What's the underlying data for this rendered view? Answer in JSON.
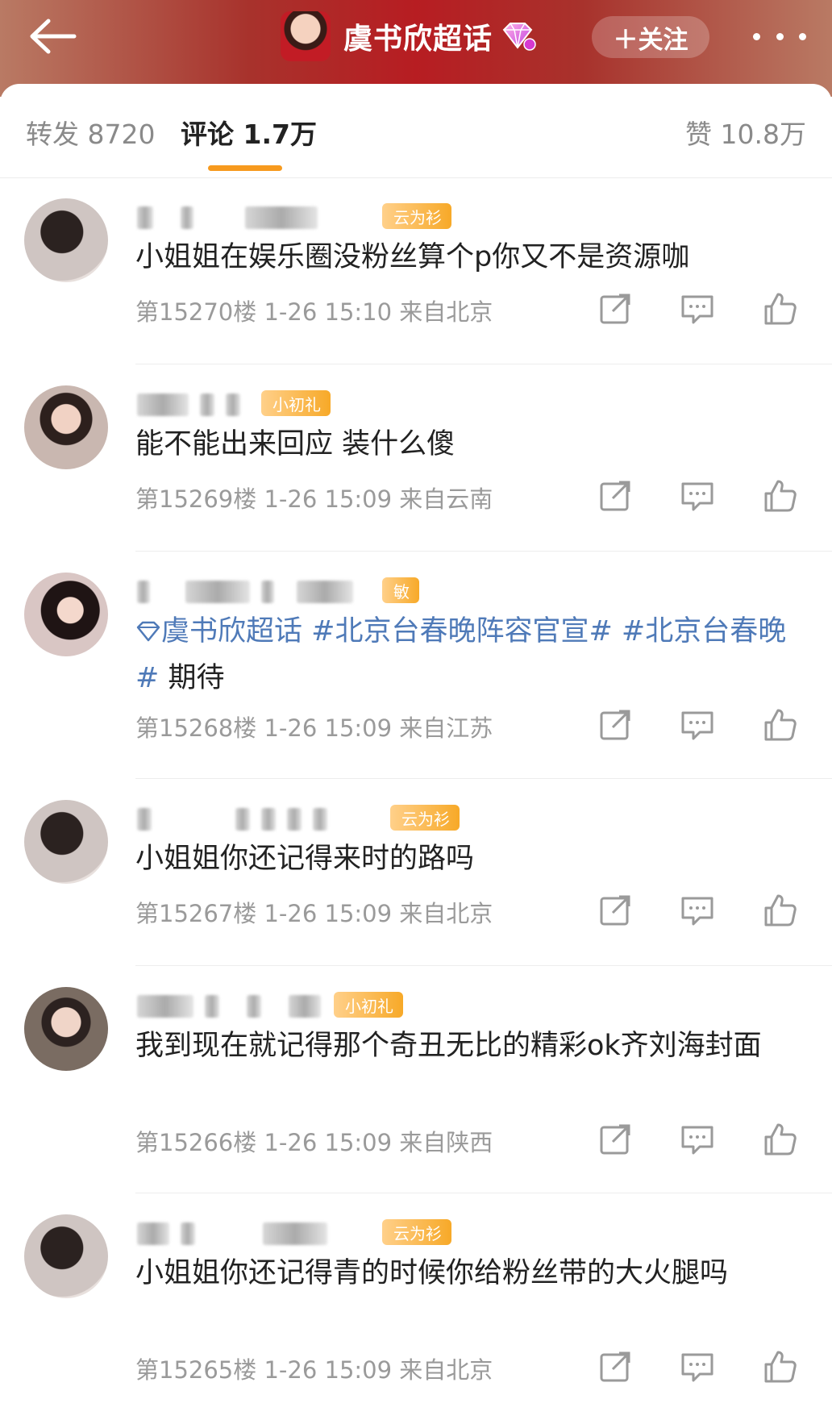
{
  "header": {
    "title": "虞书欣超话",
    "follow_label": "＋关注"
  },
  "tabs": [
    {
      "label": "转发 8720",
      "active": false
    },
    {
      "label": "评论 1.7万",
      "active": true
    },
    {
      "label": "赞 10.8万",
      "active": false
    }
  ],
  "comments": [
    {
      "badge": "云为衫",
      "text": "小姐姐在娱乐圈没粉丝算个p你又不是资源咖",
      "meta": "第15270楼  1-26 15:10  来自北京"
    },
    {
      "badge": "小初礼",
      "text": "能不能出来回应 装什么傻",
      "meta": "第15269楼  1-26 15:09  来自云南"
    },
    {
      "badge": "敏",
      "text_parts": [
        "虞书欣超话",
        " #北京台春晚阵容官宣#",
        " #北京台春晚#",
        " 期待"
      ],
      "meta": "第15268楼  1-26 15:09  来自江苏"
    },
    {
      "badge": "云为衫",
      "text": "小姐姐你还记得来时的路吗",
      "meta": "第15267楼  1-26 15:09  来自北京"
    },
    {
      "badge": "小初礼",
      "text": "我到现在就记得那个奇丑无比的精彩ok齐刘海封面",
      "meta": "第15266楼  1-26 15:09  来自陕西"
    },
    {
      "badge": "云为衫",
      "text": "小姐姐你还记得青的时候你给粉丝带的大火腿吗",
      "meta": "第15265楼  1-26 15:09  来自北京"
    }
  ],
  "colors": {
    "accent": "#f79a1e",
    "link": "#4f7ab8",
    "header": "#b71d22"
  },
  "icons": [
    "back-arrow-icon",
    "gem-icon",
    "more-icon",
    "share-icon",
    "comment-icon",
    "like-icon"
  ]
}
